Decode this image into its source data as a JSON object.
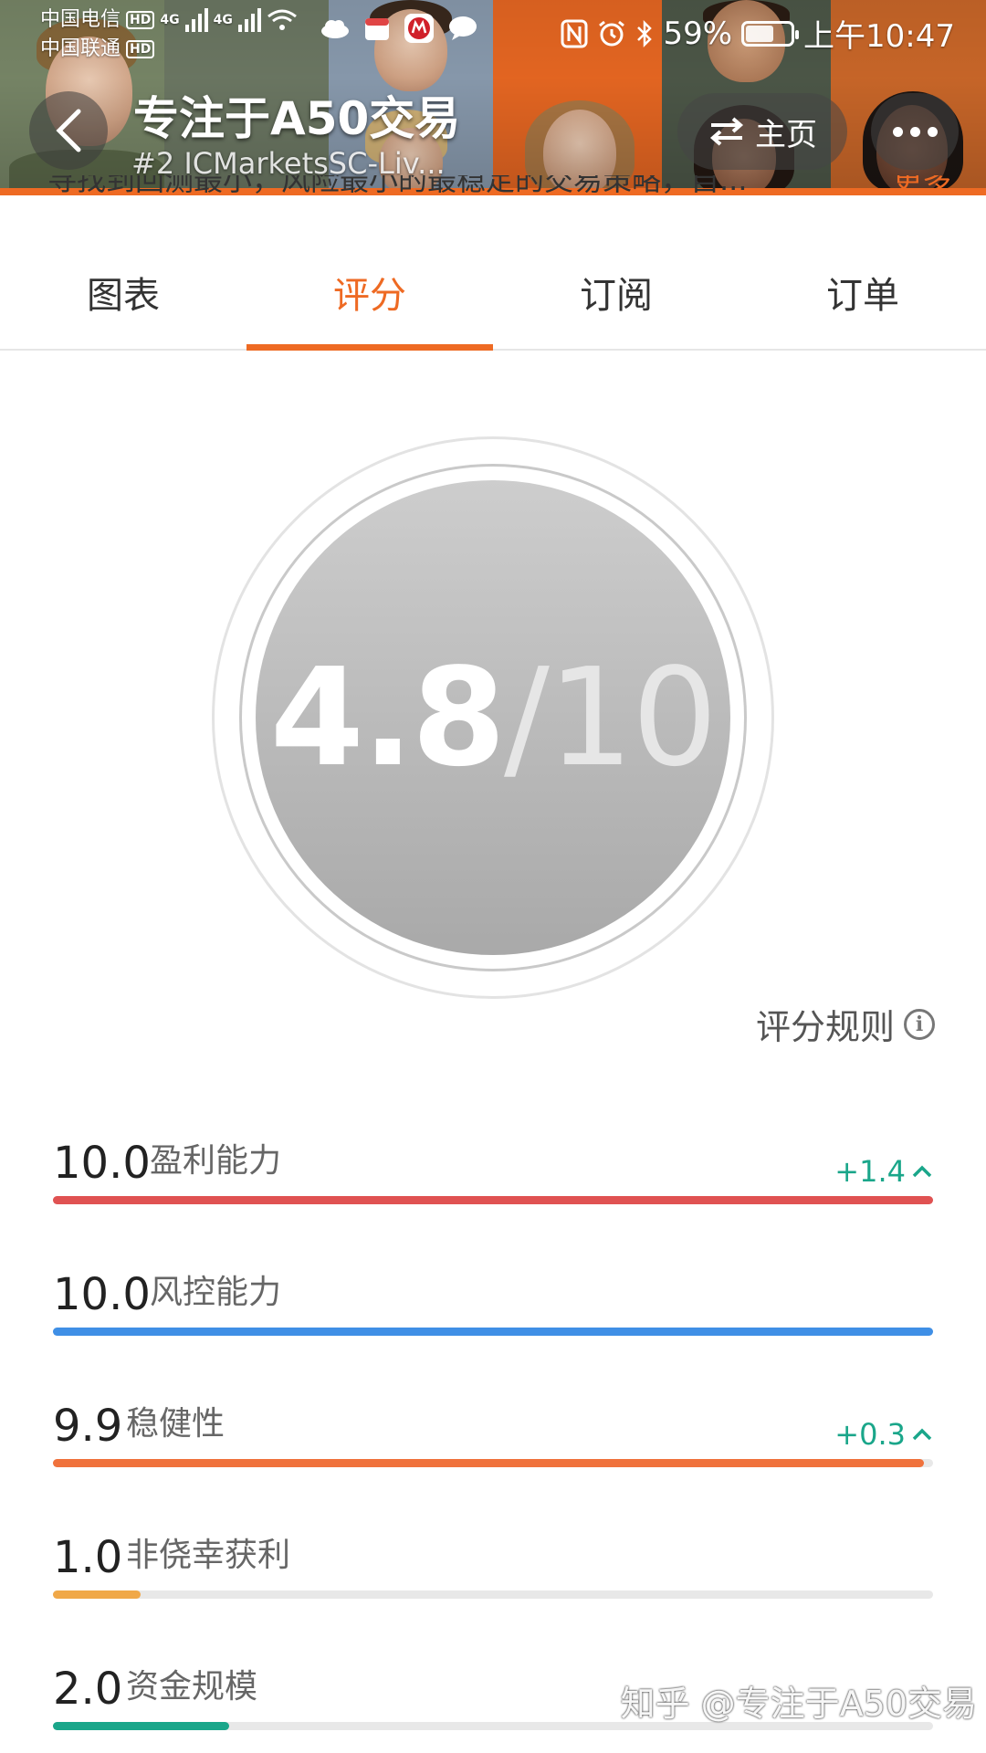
{
  "status_bar": {
    "carrier_1": "中国电信",
    "carrier_2": "中国联通",
    "hd_label": "HD",
    "net_1": "4G",
    "net_2": "4G",
    "battery": "59%",
    "time": "上午10:47"
  },
  "header": {
    "title": "专注于A50交易",
    "subtitle": "#2 ICMarketsSC-Liv...",
    "home_label": "主页",
    "description_peek": "寻找到回测最小，风险最小的最稳定的交易策略，自...",
    "more_link": "更多"
  },
  "tabs": [
    {
      "label": "图表",
      "active": false
    },
    {
      "label": "评分",
      "active": true
    },
    {
      "label": "订阅",
      "active": false
    },
    {
      "label": "订单",
      "active": false
    }
  ],
  "score": {
    "value": "4.8",
    "max": "/10"
  },
  "rules_link": "评分规则",
  "metrics": [
    {
      "value": "10.0",
      "label": "盈利能力",
      "delta": "+1.4",
      "fraction": 1.0,
      "color": "#e05252"
    },
    {
      "value": "10.0",
      "label": "风控能力",
      "delta": "",
      "fraction": 1.0,
      "color": "#3f8fe6"
    },
    {
      "value": "9.9",
      "label": "稳健性",
      "delta": "+0.3",
      "fraction": 0.99,
      "color": "#f0723c"
    },
    {
      "value": "1.0",
      "label": "非侥幸获利",
      "delta": "",
      "fraction": 0.1,
      "color": "#f0a848"
    },
    {
      "value": "2.0",
      "label": "资金规模",
      "delta": "",
      "fraction": 0.2,
      "color": "#1aa68a"
    }
  ],
  "watermark": "知乎 @专注于A50交易",
  "colors": {
    "accent": "#ee6a23",
    "positive": "#1aa68a"
  }
}
